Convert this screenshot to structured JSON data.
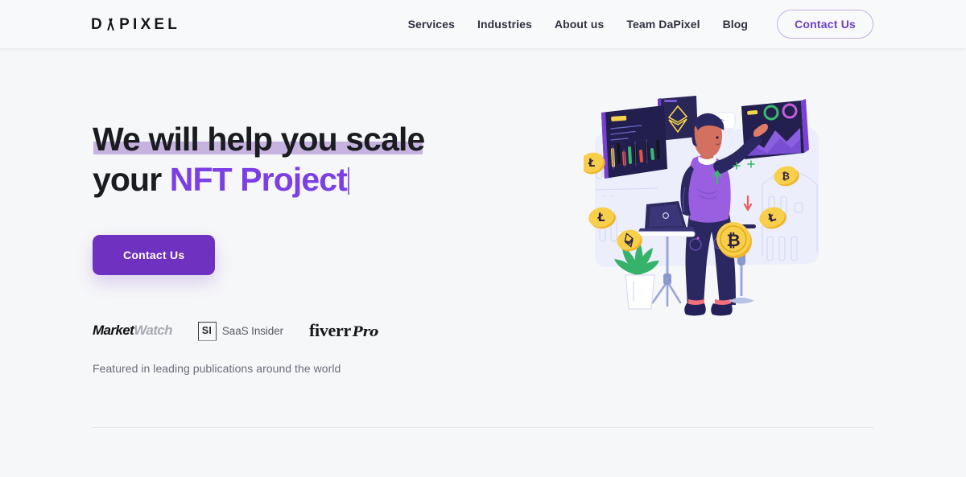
{
  "header": {
    "brand": {
      "before_a": "D",
      "a_letter": "A",
      "after_a": "PIXEL",
      "full": "DAPIXEL"
    },
    "nav": [
      {
        "label": "Services",
        "name": "nav-link-services"
      },
      {
        "label": "Industries",
        "name": "nav-link-industries"
      },
      {
        "label": "About us",
        "name": "nav-link-about-us"
      },
      {
        "label": "Team DaPixel",
        "name": "nav-link-team-dapixel"
      },
      {
        "label": "Blog",
        "name": "nav-link-blog"
      }
    ],
    "cta_label": "Contact Us"
  },
  "hero": {
    "headline_line1": "We will help you scale",
    "headline_line2_prefix": "your ",
    "headline_line2_accent": "NFT Project",
    "cta_label": "Contact Us",
    "press_caption": "Featured in leading publications around the world",
    "press_logos": [
      {
        "name": "marketwatch",
        "part_bold": "Market",
        "part_light": "Watch"
      },
      {
        "name": "saas-insider",
        "badge": "SI",
        "text": "SaaS Insider"
      },
      {
        "name": "fiverr-pro",
        "word": "fiverr",
        "suffix": "Pro"
      }
    ],
    "illustration_alt": "nft-crypto-trader-illustration"
  },
  "colors": {
    "page_background": "#f6f7f9",
    "header_background": "#f8f9fb",
    "accent_purple": "#7b3fe4",
    "button_purple": "#6f31c0",
    "highlight_lavender": "#c6b3df",
    "nav_border_purple": "#c3aee4",
    "text_dark": "#1b1c20",
    "text_muted": "#6d6e78",
    "divider": "#e4e6ea"
  }
}
